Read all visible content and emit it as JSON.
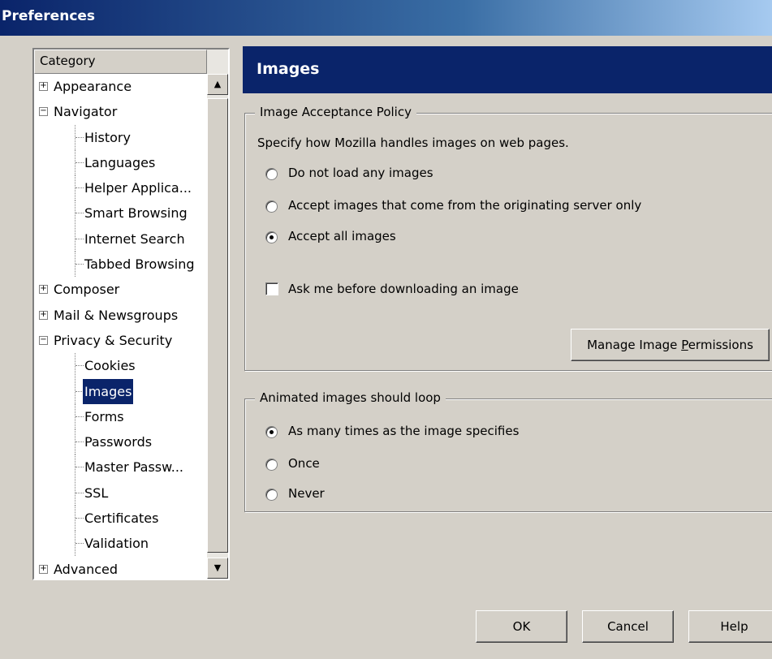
{
  "window": {
    "title": "Preferences"
  },
  "category": {
    "header": "Category",
    "items": [
      {
        "label": "Appearance",
        "level": 0,
        "expander": "+"
      },
      {
        "label": "Navigator",
        "level": 0,
        "expander": "−"
      },
      {
        "label": "History",
        "level": 1
      },
      {
        "label": "Languages",
        "level": 1
      },
      {
        "label": "Helper Applica...",
        "level": 1
      },
      {
        "label": "Smart Browsing",
        "level": 1
      },
      {
        "label": "Internet Search",
        "level": 1
      },
      {
        "label": "Tabbed Browsing",
        "level": 1
      },
      {
        "label": "Composer",
        "level": 0,
        "expander": "+"
      },
      {
        "label": "Mail & Newsgroups",
        "level": 0,
        "expander": "+"
      },
      {
        "label": "Privacy & Security",
        "level": 0,
        "expander": "−"
      },
      {
        "label": "Cookies",
        "level": 1
      },
      {
        "label": "Images",
        "level": 1,
        "selected": true
      },
      {
        "label": "Forms",
        "level": 1
      },
      {
        "label": "Passwords",
        "level": 1
      },
      {
        "label": "Master Passw...",
        "level": 1
      },
      {
        "label": "SSL",
        "level": 1
      },
      {
        "label": "Certificates",
        "level": 1
      },
      {
        "label": "Validation",
        "level": 1
      },
      {
        "label": "Advanced",
        "level": 0,
        "expander": "+"
      }
    ],
    "scroll_up_icon": "scroll-up-arrow",
    "scroll_down_icon": "scroll-down-arrow"
  },
  "panel": {
    "title": "Images",
    "acceptance": {
      "legend": "Image Acceptance Policy",
      "description": "Specify how Mozilla handles images on web pages.",
      "options": [
        {
          "label": "Do not load any images",
          "checked": false
        },
        {
          "label": "Accept images that come from the originating server only",
          "checked": false
        },
        {
          "label": "Accept all images",
          "checked": true
        }
      ],
      "ask_checkbox": {
        "label": "Ask me before downloading an image",
        "checked": false
      },
      "manage_button": {
        "pre": "Manage Image ",
        "accel": "P",
        "post": "ermissions"
      }
    },
    "animation": {
      "legend": "Animated images should loop",
      "options": [
        {
          "label": "As many times as the image specifies",
          "checked": true
        },
        {
          "label": "Once",
          "checked": false
        },
        {
          "label": "Never",
          "checked": false
        }
      ]
    }
  },
  "footer": {
    "ok": "OK",
    "cancel": "Cancel",
    "help": "Help"
  },
  "colors": {
    "title_bar": "#0a246a",
    "selection": "#0a246a",
    "dialog_bg": "#d4d0c8"
  }
}
